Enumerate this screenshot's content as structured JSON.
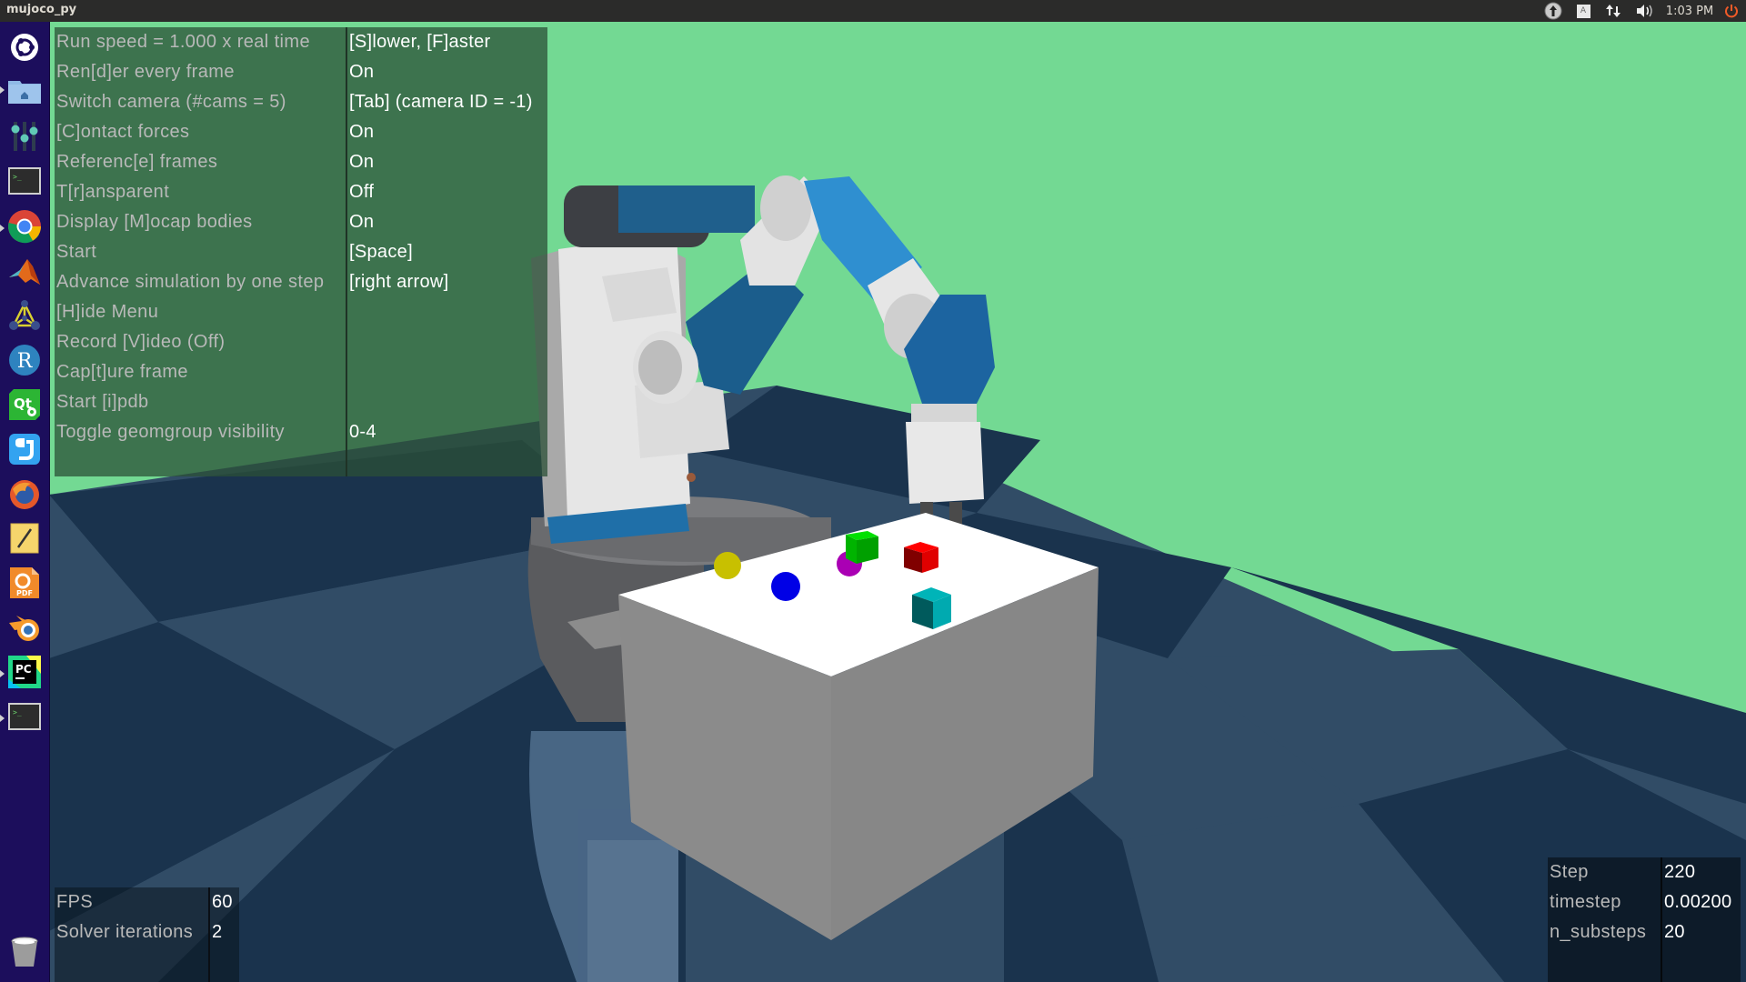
{
  "app": {
    "title": "mujoco_py"
  },
  "top_panel": {
    "clock": "1:03 PM",
    "tray_icons": [
      "update-icon",
      "keyboard-layout-icon",
      "network-icon",
      "volume-icon",
      "power-icon"
    ],
    "keyboard_layout": "A"
  },
  "launcher": {
    "items": [
      {
        "name": "ubuntu-dash",
        "icon": "ubuntu-logo-icon",
        "running": false
      },
      {
        "name": "files",
        "icon": "home-folder-icon",
        "running": true
      },
      {
        "name": "system-settings",
        "icon": "sliders-icon",
        "running": false
      },
      {
        "name": "terminal",
        "icon": "terminal-icon",
        "running": false
      },
      {
        "name": "chrome",
        "icon": "chrome-icon",
        "running": true
      },
      {
        "name": "matlab",
        "icon": "matlab-icon",
        "running": false
      },
      {
        "name": "app-network",
        "icon": "network-graph-icon",
        "running": false
      },
      {
        "name": "rstudio",
        "icon": "r-icon",
        "running": false
      },
      {
        "name": "qt-creator",
        "icon": "qt-icon",
        "running": false
      },
      {
        "name": "app-blue",
        "icon": "blue-app-icon",
        "running": false
      },
      {
        "name": "firefox",
        "icon": "firefox-icon",
        "running": false
      },
      {
        "name": "text-editor",
        "icon": "pencil-note-icon",
        "running": false
      },
      {
        "name": "foxit-pdf",
        "icon": "pdf-icon",
        "running": false
      },
      {
        "name": "blender",
        "icon": "blender-icon",
        "running": false
      },
      {
        "name": "pycharm",
        "icon": "pycharm-icon",
        "running": true
      },
      {
        "name": "terminal-2",
        "icon": "terminal-icon",
        "running": true
      },
      {
        "name": "trash",
        "icon": "trash-icon",
        "running": false
      }
    ],
    "pc_label": "PC",
    "pdf_label": "PDF",
    "r_label": "R"
  },
  "menu": {
    "rows": [
      {
        "label": "Run speed = 1.000 x real time",
        "value": "[S]lower, [F]aster"
      },
      {
        "label": "Ren[d]er every frame",
        "value": "On"
      },
      {
        "label": "Switch camera (#cams = 5)",
        "value": "[Tab] (camera ID = -1)"
      },
      {
        "label": "[C]ontact forces",
        "value": "On"
      },
      {
        "label": "Referenc[e] frames",
        "value": "On"
      },
      {
        "label": "T[r]ansparent",
        "value": "Off"
      },
      {
        "label": "Display [M]ocap bodies",
        "value": "On"
      },
      {
        "label": "Start",
        "value": "[Space]"
      },
      {
        "label": "Advance simulation by one step",
        "value": "[right arrow]"
      },
      {
        "label": "[H]ide Menu",
        "value": ""
      },
      {
        "label": "Record [V]ideo (Off)",
        "value": ""
      },
      {
        "label": "Cap[t]ure frame",
        "value": ""
      },
      {
        "label": "Start [i]pdb",
        "value": ""
      },
      {
        "label": "Toggle geomgroup visibility",
        "value": "0-4"
      }
    ]
  },
  "stats": {
    "rows": [
      {
        "label": "FPS",
        "value": "60"
      },
      {
        "label": "Solver iterations",
        "value": "2"
      }
    ]
  },
  "sim_info": {
    "rows": [
      {
        "label": "Step",
        "value": "220"
      },
      {
        "label": "timestep",
        "value": "0.00200"
      },
      {
        "label": "n_substeps",
        "value": "20"
      }
    ]
  },
  "scene": {
    "wall_color": "#73d993",
    "floor_dark": "#1a334d",
    "floor_light": "#314c66",
    "robot_blue": "#2a7fc0",
    "robot_white": "#e8e8e8",
    "robot_dark": "#3e4045",
    "table_top": "#ffffff",
    "table_front": "#8b8b8b",
    "table_side": "#878787",
    "objects": [
      {
        "name": "yellow-sphere",
        "shape": "sphere",
        "color": "#c8c000"
      },
      {
        "name": "blue-sphere",
        "shape": "sphere",
        "color": "#0000e6"
      },
      {
        "name": "purple-sphere",
        "shape": "sphere",
        "color": "#aa00b4"
      },
      {
        "name": "green-cube",
        "shape": "cube",
        "color": "#00b400"
      },
      {
        "name": "red-cube",
        "shape": "cube",
        "color": "#e00000"
      },
      {
        "name": "cyan-cube",
        "shape": "cube",
        "color": "#00aab0"
      }
    ]
  }
}
